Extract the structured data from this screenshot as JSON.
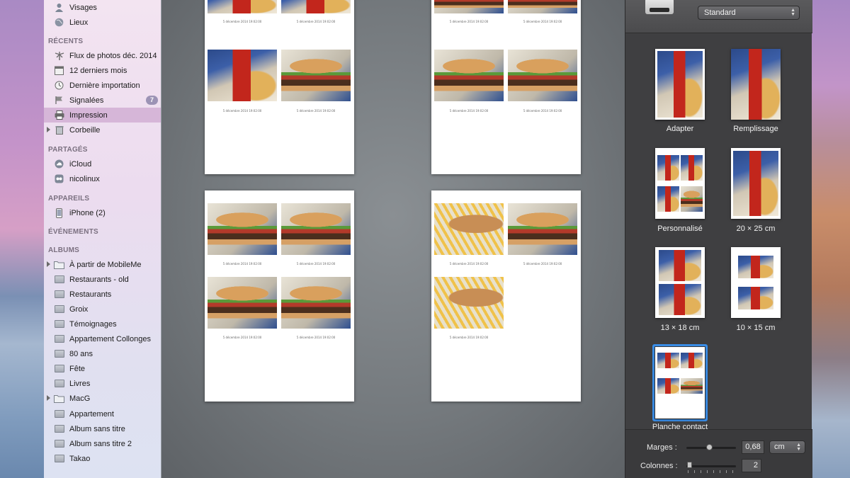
{
  "sidebar": {
    "top_items": [
      {
        "label": "Visages",
        "icon": "person-icon"
      },
      {
        "label": "Lieux",
        "icon": "globe-icon"
      }
    ],
    "sections": {
      "recents": "RÉCENTS",
      "partages": "PARTAGÉS",
      "appareils": "APPAREILS",
      "evenements": "ÉVÉNEMENTS",
      "albums": "ALBUMS"
    },
    "recents": [
      {
        "label": "Flux de photos déc. 2014",
        "icon": "photostream-icon"
      },
      {
        "label": "12 derniers mois",
        "icon": "calendar-icon"
      },
      {
        "label": "Dernière importation",
        "icon": "clock-icon"
      },
      {
        "label": "Signalées",
        "icon": "flag-icon",
        "badge": "7"
      },
      {
        "label": "Impression",
        "icon": "printer-icon",
        "selected": true
      },
      {
        "label": "Corbeille",
        "icon": "trash-icon"
      }
    ],
    "partages": [
      {
        "label": "iCloud",
        "icon": "cloud-icon"
      },
      {
        "label": "nicolinux",
        "icon": "shared-stream-icon"
      }
    ],
    "appareils": [
      {
        "label": "iPhone (2)",
        "icon": "iphone-icon"
      }
    ],
    "albums": [
      "À partir de MobileMe",
      "Restaurants - old",
      "Restaurants",
      "Groix",
      "Témoignages",
      "Appartement Collonges",
      "80 ans",
      "Fête",
      "Livres",
      "MacG",
      "Appartement",
      "Album sans titre",
      "Album sans titre 2",
      "Takao"
    ]
  },
  "preview": {
    "caption": "5 décembre 2014 19:02:00"
  },
  "panel": {
    "paper_size": "Standard",
    "presets": [
      "Adapter",
      "Remplissage",
      "Personnalisé",
      "20 × 25 cm",
      "13 × 18 cm",
      "10 × 15 cm",
      "Planche contact"
    ],
    "selected_preset": "Planche contact",
    "margins_label": "Marges :",
    "margins_value": "0,68",
    "margins_level": 0.45,
    "unit": "cm",
    "columns_label": "Colonnes :",
    "columns_value": "2"
  }
}
